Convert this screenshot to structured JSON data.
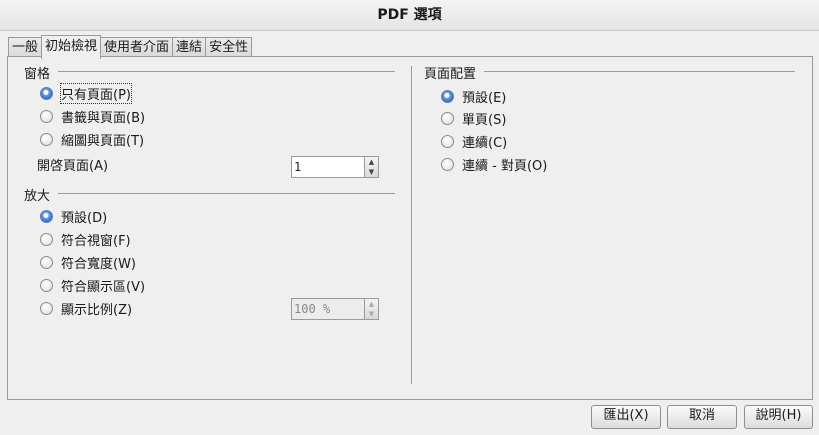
{
  "window": {
    "title": "PDF 選項"
  },
  "tabs": [
    {
      "label": "一般"
    },
    {
      "label": "初始檢視"
    },
    {
      "label": "使用者介面"
    },
    {
      "label": "連結"
    },
    {
      "label": "安全性"
    }
  ],
  "pane": {
    "title": "窗格",
    "options": [
      {
        "label": "只有頁面(P)",
        "selected": true
      },
      {
        "label": "書籤與頁面(B)",
        "selected": false
      },
      {
        "label": "縮圖與頁面(T)",
        "selected": false
      }
    ],
    "open_page_label": "開啓頁面(A)",
    "open_page_value": "1"
  },
  "magnification": {
    "title": "放大",
    "options": [
      {
        "label": "預設(D)",
        "selected": true
      },
      {
        "label": "符合視窗(F)",
        "selected": false
      },
      {
        "label": "符合寬度(W)",
        "selected": false
      },
      {
        "label": "符合顯示區(V)",
        "selected": false
      },
      {
        "label": "顯示比例(Z)",
        "selected": false
      }
    ],
    "zoom_value": "100 %"
  },
  "page_layout": {
    "title": "頁面配置",
    "options": [
      {
        "label": "預設(E)",
        "selected": true
      },
      {
        "label": "單頁(S)",
        "selected": false
      },
      {
        "label": "連續(C)",
        "selected": false
      },
      {
        "label": "連續 - 對頁(O)",
        "selected": false
      }
    ]
  },
  "buttons": {
    "export": "匯出(X)",
    "cancel": "取消",
    "help": "說明(H)"
  },
  "colors": {
    "radio_selected": "#3a72c8",
    "background": "#efefef"
  }
}
